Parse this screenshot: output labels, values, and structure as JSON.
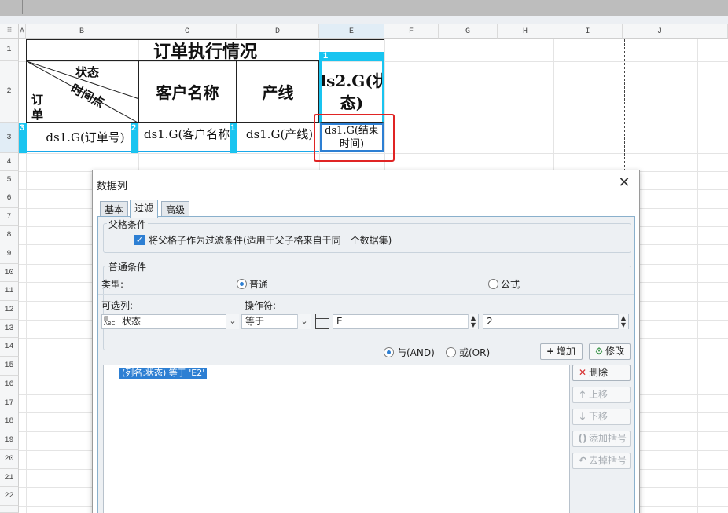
{
  "sheet": {
    "corner_label": "⁝⁝⁝",
    "columns": [
      "A",
      "B",
      "C",
      "D",
      "E",
      "F",
      "G",
      "H",
      "I",
      "J"
    ],
    "rows": [
      "1",
      "2",
      "3",
      "4",
      "5",
      "6",
      "7",
      "8",
      "9",
      "10",
      "11",
      "12",
      "13",
      "14",
      "15",
      "16",
      "17",
      "18",
      "19",
      "20",
      "21",
      "22"
    ],
    "title": "订单执行情况",
    "diagonal_header": {
      "top": "状态",
      "middle": "时间点",
      "bottom_1": "订",
      "bottom_2": "单"
    },
    "headers": {
      "customer": "客户名称",
      "line": "产线",
      "status": "ds2.G(状态)"
    },
    "data": {
      "order": "ds1.G(订单号)",
      "customer": "ds1.G(客户名称)",
      "line": "ds1.G(产线)",
      "end_time": "ds1.G(结束时间)"
    },
    "cell_marks": {
      "status_header": "1",
      "order": "3",
      "customer": "2",
      "line": "1"
    },
    "accent_color": "#19c4f0",
    "highlight_color": "#e02424"
  },
  "dialog": {
    "title": "数据列",
    "close_icon": "close-icon",
    "tabs": [
      "基本",
      "过滤",
      "高级"
    ],
    "active_tab": "过滤",
    "parent_group": {
      "title": "父格条件",
      "checkbox_label": "将父格子作为过滤条件(适用于父子格来自于同一个数据集)",
      "checked": true
    },
    "normal_group": {
      "title": "普通条件",
      "type_label": "类型:",
      "type_normal": "普通",
      "type_formula": "公式",
      "selected_type": "普通",
      "column_label": "可选列:",
      "operator_label": "操作符:",
      "column_value": "状态",
      "operator_value": "等于",
      "value_1": "E",
      "value_2": "2",
      "and_label": "与(AND)",
      "or_label": "或(OR)",
      "selected_logic": "与(AND)",
      "add_button": "增加",
      "modify_button": "修改",
      "condition": "(列名:状态) 等于 'E2'",
      "delete_button": "删除",
      "up_button": "上移",
      "down_button": "下移",
      "add_bracket_button": "添加括号",
      "remove_bracket_button": "去掉括号"
    }
  }
}
